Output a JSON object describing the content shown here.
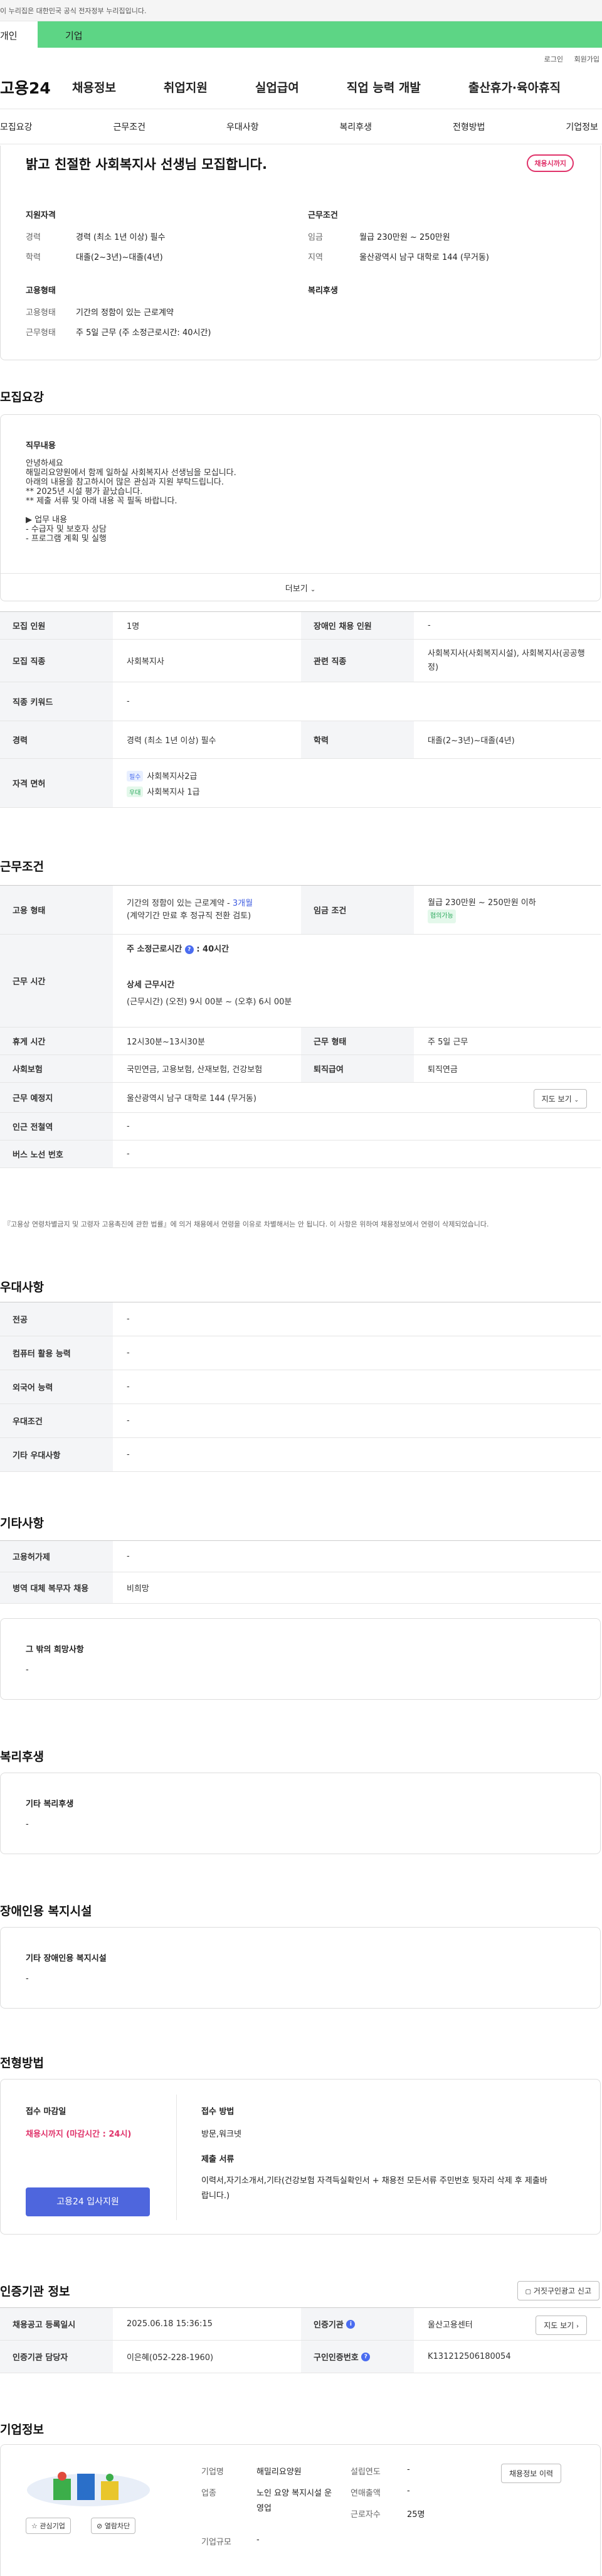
{
  "topbar": {
    "notice": "이 누리집은 대한민국 공식 전자정부 누리집입니다."
  },
  "usertabs": {
    "personal": "개인",
    "company": "기업"
  },
  "utilnav": {
    "login": "로그인",
    "join": "회원가입"
  },
  "gnb": {
    "logo": "고용24",
    "items": [
      "채용정보",
      "취업지원",
      "실업급여",
      "직업 능력 개발",
      "출산휴가·육아휴직"
    ]
  },
  "subnav": [
    "모집요강",
    "근무조건",
    "우대사항",
    "복리후생",
    "전형방법",
    "기업정보"
  ],
  "summary": {
    "title": "밝고 친절한 사회복지사 선생님 모집합니다.",
    "badge": "채용시까지",
    "qualification_heading": "지원자격",
    "conditions_heading": "근무조건",
    "employment_heading": "고용형태",
    "welfare_heading": "복리후생",
    "career_label": "경력",
    "career_value": "경력 (최소 1년 이상) 필수",
    "education_label": "학력",
    "education_value": "대졸(2~3년)~대졸(4년)",
    "wage_label": "임금",
    "wage_value": "월급 230만원 ~ 250만원",
    "region_label": "지역",
    "region_value": "울산광역시 남구 대학로 144 (무거동)",
    "emp_type_label": "고용형태",
    "emp_type_value": "기간의 정함이 있는 근로계약",
    "work_type_label": "근무형태",
    "work_type_value": "주 5일 근무 (주 소정근로시간: 40시간)"
  },
  "recruit": {
    "heading": "모집요강",
    "desc_heading": "직무내용",
    "desc_lines": [
      "안녕하세요",
      "해밀리요양원에서 함께 일하실 사회복지사 선생님을 모십니다.",
      "아래의 내용을 참고하시어 많은 관심과 지원 부탁드립니다.",
      "** 2025년 시설 평가 끝났습니다.",
      "** 제출 서류 및 아래 내용 꼭 필독 바랍니다.",
      "",
      "▶ 업무 내용",
      "- 수급자 및 보호자 상담",
      "- 프로그램 계획 및 실행"
    ],
    "more_label": "더보기",
    "headcount_label": "모집 인원",
    "headcount_value": "1명",
    "disabled_label": "장애인 채용 인원",
    "disabled_value": "-",
    "job_label": "모집 직종",
    "job_value": "사회복지사",
    "related_label": "관련 직종",
    "related_value": "사회복지사(사회복지시설), 사회복지사(공공행정)",
    "keyword_label": "직종 키워드",
    "keyword_value": "-",
    "career_label": "경력",
    "career_value": "경력 (최소 1년 이상) 필수",
    "edu_label": "학력",
    "edu_value": "대졸(2~3년)~대졸(4년)",
    "license_label": "자격 면허",
    "licenses": [
      {
        "tag": "필수",
        "name": "사회복지사2급"
      },
      {
        "tag": "우대",
        "name": "사회복지사 1급"
      }
    ]
  },
  "work": {
    "heading": "근무조건",
    "emp_label": "고용 형태",
    "emp_value": "기간의 정함이 있는 근로계약 - ",
    "emp_period": "3개월",
    "emp_note": "(계약기간 만료 후 정규직 전환 검토)",
    "wage_label": "임금 조건",
    "wage_value": "월급 230만원 ~ 250만원 이하",
    "wage_tag": "협의가능",
    "hours_label": "근무 시간",
    "hours_main": "주 소정근로시간",
    "hours_main_value": ": 40시간",
    "hours_detail_heading": "상세 근무시간",
    "hours_detail_value": "(근무시간) (오전) 9시 00분 ~ (오후) 6시 00분",
    "break_label": "휴게 시간",
    "break_value": "12시30분~13시30분",
    "worktype_label": "근무 형태",
    "worktype_value": "주 5일 근무",
    "insurance_label": "사회보험",
    "insurance_value": "국민연금, 고용보험, 산재보험, 건강보험",
    "severance_label": "퇴직급여",
    "severance_value": "퇴직연금",
    "place_label": "근무 예정지",
    "place_value": "울산광역시 남구 대학로 144 (무거동)",
    "map_btn": "지도 보기",
    "subway_label": "인근 전철역",
    "subway_value": "-",
    "bus_label": "버스 노선 번호",
    "bus_value": "-",
    "footnote": "『고용상 연령차별금지 및 고령자 고용촉진에 관한 법률』에 의거 채용에서 연령을 이유로 차별해서는 안 됩니다. 이 사항은 위하여 채용정보에서 연령이 삭제되었습니다."
  },
  "preference": {
    "heading": "우대사항",
    "rows": [
      {
        "label": "전공",
        "value": "-"
      },
      {
        "label": "컴퓨터 활용 능력",
        "value": "-"
      },
      {
        "label": "외국어 능력",
        "value": "-"
      },
      {
        "label": "우대조건",
        "value": "-"
      },
      {
        "label": "기타 우대사항",
        "value": "-"
      }
    ]
  },
  "etc": {
    "heading": "기타사항",
    "rows": [
      {
        "label": "고용허가제",
        "value": "-"
      },
      {
        "label": "병역 대체 복무자 채용",
        "value": "비희망"
      }
    ],
    "other_heading": "그 밖의 희망사항",
    "other_value": "-"
  },
  "welfare": {
    "heading": "복리후생",
    "sub": "기타 복리후생",
    "value": "-"
  },
  "disabled": {
    "heading": "장애인용 복지시설",
    "sub": "기타 장애인용 복지시설",
    "value": "-"
  },
  "process": {
    "heading": "전형방법",
    "deadline_heading": "접수 마감일",
    "deadline_value": "채용시까지 (마감시간 : 24시)",
    "apply_btn": "고용24 입사지원",
    "method_heading": "접수 방법",
    "method_value": "방문,워크넷",
    "docs_heading": "제출 서류",
    "docs_value": "이력서,자기소개서,기타(건강보험 자격득실확인서 + 채용전 모든서류 주민번호 뒷자리 삭제 후 제출바랍니다.)"
  },
  "cert": {
    "heading": "인증기관 정보",
    "report_btn": "거짓구인광고 신고",
    "reg_label": "채용공고 등록일시",
    "reg_value": "2025.06.18 15:36:15",
    "org_label": "인증기관",
    "org_value": "울산고용센터",
    "map_btn": "지도 보기",
    "manager_label": "인증기관 담당자",
    "manager_value": "이은혜(052-228-1960)",
    "number_label": "구인인증번호",
    "number_value": "K131212506180054"
  },
  "company": {
    "heading": "기업정보",
    "name_label": "기업명",
    "name_value": "해밀리요양원",
    "industry_label": "업종",
    "industry_value": "노인 요양 복지시설 운영업",
    "size_label": "기업규모",
    "size_value": "-",
    "founded_label": "설립연도",
    "founded_value": "-",
    "revenue_label": "연매출액",
    "revenue_value": "-",
    "employees_label": "근로자수",
    "employees_value": "25명",
    "history_btn": "채용정보 이력",
    "fav_btn": "관심기업",
    "block_btn": "열람차단"
  }
}
